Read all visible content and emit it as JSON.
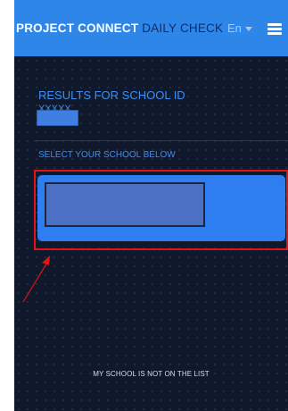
{
  "header": {
    "brand_primary": "PROJECT CONNECT",
    "brand_secondary": "DAILY CHECK",
    "language": "En",
    "menu_icon": "hamburger-menu-icon"
  },
  "results": {
    "title": "RESULTS FOR SCHOOL ID",
    "id_partial": "XXXXX"
  },
  "select_label": "SELECT YOUR SCHOOL BELOW",
  "footer_link": "MY SCHOOL IS NOT ON THE LIST",
  "colors": {
    "header_bg": "#2f86e9",
    "main_bg": "#10192b",
    "accent_text": "#3d8ef0",
    "card_bg": "#2e7df1",
    "annotation_red": "#e01515"
  }
}
